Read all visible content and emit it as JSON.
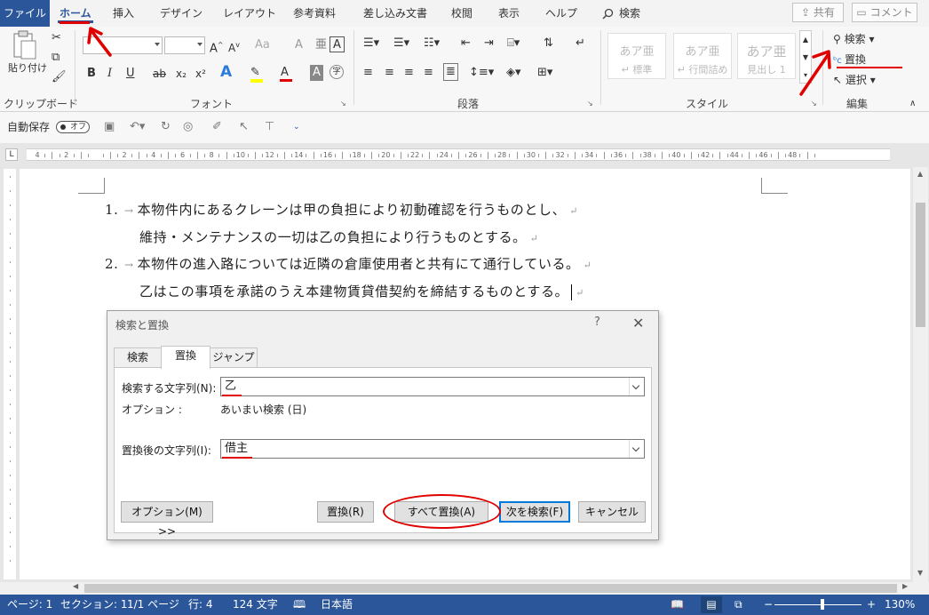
{
  "tabs": {
    "file": "ファイル",
    "home": "ホーム",
    "insert": "挿入",
    "design": "デザイン",
    "layout": "レイアウト",
    "references": "参考資料",
    "mailings": "差し込み文書",
    "review": "校閲",
    "view": "表示",
    "help": "ヘルプ",
    "search": "検索",
    "share": "共有",
    "comment": "コメント"
  },
  "ribbon": {
    "clipboard": {
      "paste": "貼り付け",
      "label": "クリップボード"
    },
    "font": {
      "label": "フォント",
      "bold": "B",
      "italic": "I",
      "underline": "U",
      "strike": "ab",
      "subscript": "x₂",
      "superscript": "x²",
      "grow": "A",
      "shrink": "A",
      "case": "Aa",
      "clear": "A",
      "box": "A",
      "effects": "A",
      "color": "A",
      "shade": "A",
      "enclose": "字"
    },
    "paragraph": {
      "label": "段落"
    },
    "styles": {
      "label": "スタイル",
      "items": [
        {
          "sample": "あア亜",
          "name": "↵ 標準"
        },
        {
          "sample": "あア亜",
          "name": "↵ 行間詰め"
        },
        {
          "sample": "あア亜",
          "name": "見出し 1"
        }
      ]
    },
    "editing": {
      "label": "編集",
      "find": "検索",
      "replace": "置換",
      "select": "選択"
    }
  },
  "qat": {
    "autosave": "自動保存",
    "autosave_state": "オフ"
  },
  "ruler": {
    "numbers": [
      "4",
      "2",
      "",
      "2",
      "4",
      "6",
      "8",
      "10",
      "12",
      "14",
      "16",
      "18",
      "20",
      "22",
      "24",
      "26",
      "28",
      "30",
      "32",
      "34",
      "36",
      "38",
      "40",
      "42",
      "44",
      "46",
      "48"
    ]
  },
  "document": {
    "lines": [
      {
        "num": "1.",
        "text": "本物件内にあるクレーンは甲の負担により初動確認を行うものとし、"
      },
      {
        "num": "",
        "text": "維持・メンテナンスの一切は乙の負担により行うものとする。"
      },
      {
        "num": "2.",
        "text": "本物件の進入路については近隣の倉庫使用者と共有にて通行している。"
      },
      {
        "num": "",
        "text": "乙はこの事項を承諾のうえ本建物賃貸借契約を締結するものとする。"
      }
    ],
    "para_mark": "↵",
    "tab_mark": "→"
  },
  "dialog": {
    "title": "検索と置換",
    "help": "?",
    "close": "✕",
    "tabs": [
      "検索",
      "置換",
      "ジャンプ"
    ],
    "find_label": "検索する文字列(N):",
    "find_value": "乙",
    "options_label": "オプション :",
    "options_value": "あいまい検索 (日)",
    "replace_label": "置換後の文字列(I):",
    "replace_value": "借主",
    "buttons": {
      "options": "オプション(M) >>",
      "replace": "置換(R)",
      "replace_all": "すべて置換(A)",
      "find_next": "次を検索(F)",
      "cancel": "キャンセル"
    }
  },
  "status": {
    "page": "ページ: 1",
    "section": "セクション: 1",
    "pages": "1/1 ページ",
    "line": "行: 4",
    "chars": "124 文字",
    "language": "日本語",
    "zoom": "130%",
    "zoom_minus": "−",
    "zoom_plus": "+"
  },
  "colors": {
    "brand": "#2b579a",
    "annotation": "#e00000"
  }
}
